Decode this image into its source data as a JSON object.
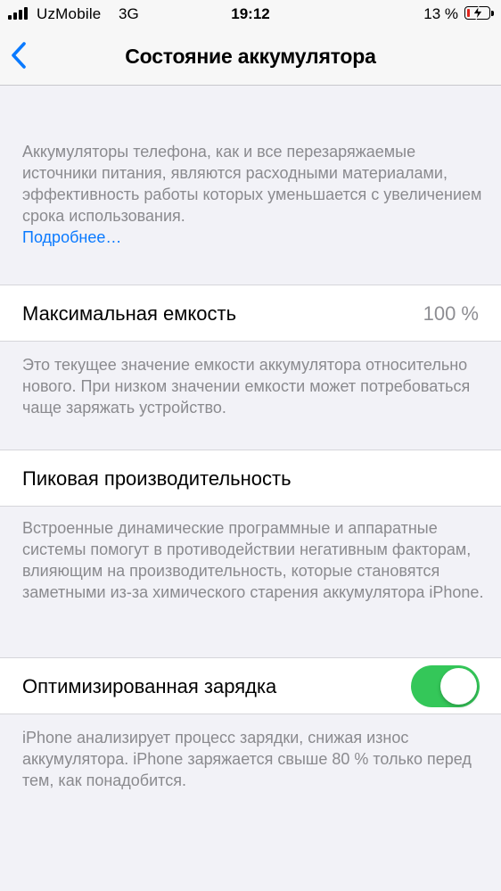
{
  "status_bar": {
    "carrier": "UzMobile",
    "network": "3G",
    "time": "19:12",
    "battery_percent": "13 %",
    "battery_level": 0.13,
    "battery_color": "#e0231b",
    "charging": true
  },
  "nav": {
    "back_icon": "chevron-left-icon",
    "title": "Состояние аккумулятора"
  },
  "intro": {
    "text": "Аккумуляторы телефона, как и все перезаряжаемые источники питания, являются расходными материалами, эффективность работы которых уменьшается с увеличением срока использования.",
    "link": "Подробнее…"
  },
  "max_capacity": {
    "label": "Максимальная емкость",
    "value": "100 %",
    "footer": "Это текущее значение емкости аккумулятора относительно нового. При низком значении емкости может потребоваться чаще заряжать устройство."
  },
  "peak_performance": {
    "label": "Пиковая производительность",
    "footer": "Встроенные динамические программные и аппаратные системы помогут в противодействии негативным факторам, влияющим на производительность, которые становятся заметными из-за химического старения аккумулятора iPhone."
  },
  "optimized_charging": {
    "label": "Оптимизированная зарядка",
    "enabled": true,
    "toggle_color": "#34c759",
    "footer": "iPhone анализирует процесс зарядки, снижая износ аккумулятора. iPhone заряжается свыше 80 % только перед тем, как понадобится."
  },
  "colors": {
    "link": "#0a7aff",
    "background": "#f2f2f7"
  }
}
